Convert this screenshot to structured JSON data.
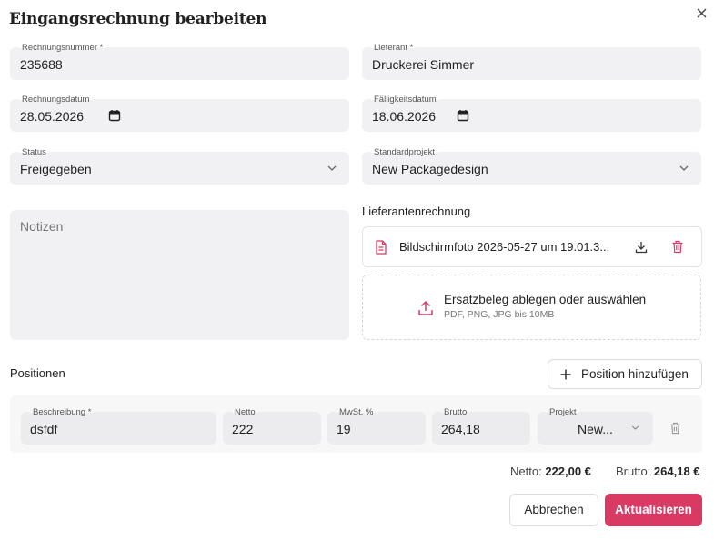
{
  "dialog": {
    "title": "Eingangsrechnung bearbeiten"
  },
  "fields": {
    "invoice_number": {
      "label": "Rechnungsnummer *",
      "value": "235688"
    },
    "supplier": {
      "label": "Lieferant *",
      "value": "Druckerei Simmer"
    },
    "invoice_date": {
      "label": "Rechnungsdatum",
      "value": "28.05.2026"
    },
    "due_date": {
      "label": "Fälligkeitsdatum",
      "value": "18.06.2026"
    },
    "status": {
      "label": "Status",
      "value": "Freigegeben"
    },
    "default_project": {
      "label": "Standardprojekt",
      "value": "New Packagedesign"
    },
    "notes": {
      "placeholder": "Notizen"
    }
  },
  "supplier_invoice": {
    "heading": "Lieferantenrechnung",
    "file_name": "Bildschirmfoto 2026-05-27 um 19.01.3...",
    "dropzone_title": "Ersatzbeleg ablegen oder auswählen",
    "dropzone_hint": "PDF, PNG, JPG bis 10MB"
  },
  "positions": {
    "heading": "Positionen",
    "add_label": "Position hinzufügen",
    "rows": [
      {
        "description_label": "Beschreibung *",
        "description": "dsfdf",
        "net_label": "Netto",
        "net": "222",
        "vat_label": "MwSt. %",
        "vat": "19",
        "gross_label": "Brutto",
        "gross": "264,18",
        "project_label": "Projekt",
        "project": "New..."
      }
    ]
  },
  "totals": {
    "net_label": "Netto:",
    "net_value": "222,00 €",
    "gross_label": "Brutto:",
    "gross_value": "264,18 €"
  },
  "actions": {
    "cancel": "Abbrechen",
    "submit": "Aktualisieren"
  },
  "colors": {
    "accent": "#d83a64",
    "field_bg": "#f1f1f3"
  }
}
